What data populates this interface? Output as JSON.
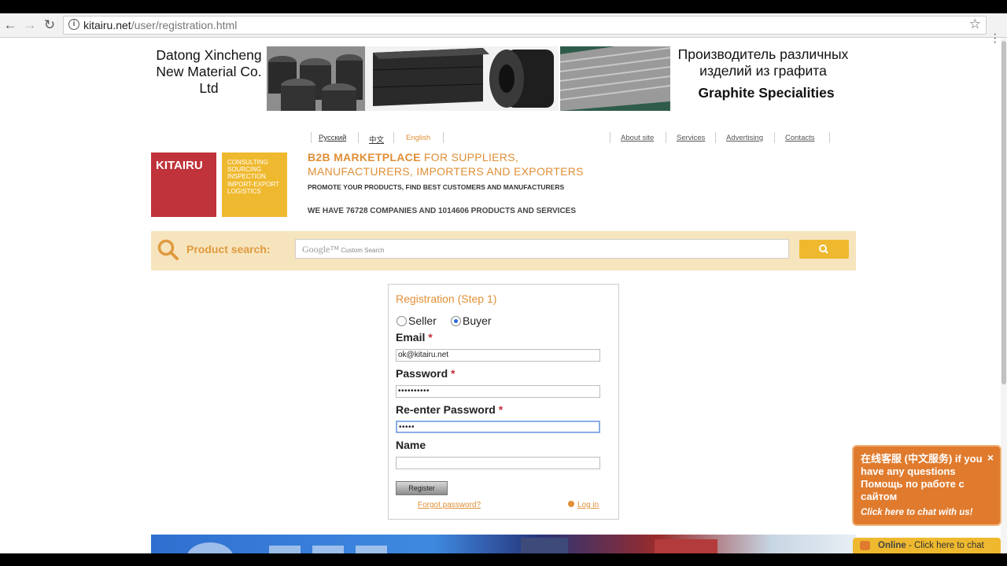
{
  "browser": {
    "url_host": "kitairu.net",
    "url_path": "/user/registration.html"
  },
  "banner": {
    "company": "Datong Xincheng New Material Co. Ltd",
    "russian_line": "Производитель различных изделий из графита",
    "specialty": "Graphite Specialities"
  },
  "langs": [
    {
      "label": "Русский"
    },
    {
      "label": "中文"
    },
    {
      "label": "English"
    }
  ],
  "top_links": [
    {
      "label": "About site"
    },
    {
      "label": "Services"
    },
    {
      "label": "Advertising"
    },
    {
      "label": "Contacts"
    }
  ],
  "logo": {
    "name": "KITAIRU",
    "services": [
      "CONSULTING",
      "SOURCING",
      "INSPECTION",
      "IMPORT-EXPORT",
      "LOGISTICS"
    ]
  },
  "tagline": {
    "part1": "B2B MARKETPLACE",
    "part2": " FOR SUPPLIERS,",
    "line2": "MANUFACTURERS, IMPORTERS AND EXPORTERS",
    "promo": "PROMOTE YOUR PRODUCTS, FIND BEST CUSTOMERS AND MANUFACTURERS",
    "count": "WE HAVE 76728 COMPANIES AND 1014606 PRODUCTS AND SERVICES"
  },
  "search": {
    "label": "Product search:",
    "google": "Google™",
    "placeholder": "Custom Search"
  },
  "form": {
    "title": "Registration (Step 1)",
    "role_seller": "Seller",
    "role_buyer": "Buyer",
    "selected_role": "Buyer",
    "email_label": "Email",
    "email_value": "ok@kitairu.net",
    "password_label": "Password",
    "password_value": "••••••••••",
    "reenter_label": "Re-enter Password",
    "reenter_value": "•••••",
    "name_label": "Name",
    "name_value": "",
    "required_mark": "*",
    "register_label": "Register",
    "forgot_label": "Forgot password?",
    "login_label": "Log in"
  },
  "chat": {
    "message": "在线客服 (中文服务) if you have any questions Помощь по работе с сайтом",
    "link": "Click here to chat with us!",
    "status": "Online",
    "bar_text": " - Click here to chat"
  },
  "colors": {
    "accent_orange": "#e08f36",
    "brand_red": "#c0333a",
    "brand_yellow": "#efb92f",
    "search_bg": "#f6e4bd"
  }
}
